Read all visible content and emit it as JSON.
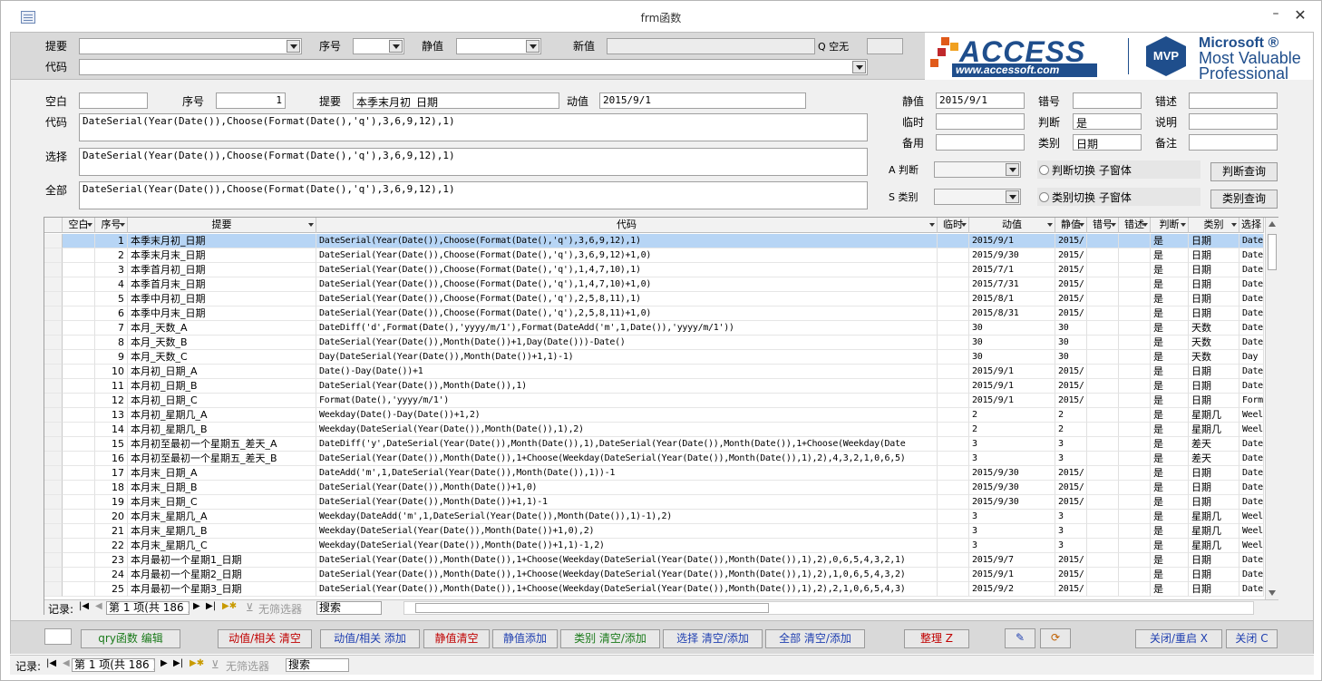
{
  "window": {
    "title": "frm函数",
    "minimize": "–",
    "close": "✕"
  },
  "header": {
    "tiyao_label": "提要",
    "xuhao_label": "序号",
    "jingzhi_label": "静值",
    "xinzhi_label": "新值",
    "q_label": "Q 空无",
    "daima_label": "代码"
  },
  "logo": {
    "access": "ACCESS",
    "url": "www.accessoft.com",
    "mvp": "MVP",
    "ms1": "Microsoft ®",
    "ms2": "Most Valuable",
    "ms3": "Professional"
  },
  "detail": {
    "kongbai_label": "空白",
    "kongbai_value": "",
    "xuhao_label": "序号",
    "xuhao_value": "1",
    "tiyao_label": "提要",
    "tiyao_value": "本季末月初_日期",
    "dongzhi_label": "动值",
    "dongzhi_value": "2015/9/1",
    "jingzhi_label": "静值",
    "jingzhi_value": "2015/9/1",
    "cuohao_label": "错号",
    "cuohao_value": "",
    "cuoshu_label": "错述",
    "cuoshu_value": "",
    "daima_label": "代码",
    "daima_value": "DateSerial(Year(Date()),Choose(Format(Date(),'q'),3,6,9,12),1)",
    "linshi_label": "临时",
    "linshi_value": "",
    "panduan_label": "判断",
    "panduan_value": "是",
    "shuoming_label": "说明",
    "shuoming_value": "",
    "beiyong_label": "备用",
    "beiyong_value": "",
    "leibie_label": "类别",
    "leibie_value": "日期",
    "beizhu_label": "备注",
    "beizhu_value": "",
    "xuanze_label": "选择",
    "xuanze_value": "DateSerial(Year(Date()),Choose(Format(Date(),'q'),3,6,9,12),1)",
    "quanbu_label": "全部",
    "quanbu_value": "DateSerial(Year(Date()),Choose(Format(Date(),'q'),3,6,9,12),1)",
    "a_panduan_label": "A 判断",
    "s_leibie_label": "S 类别",
    "panduan_switch": "判断切换 子窗体",
    "leibie_switch": "类别切换 子窗体",
    "panduan_query": "判断查询",
    "leibie_query": "类别查询"
  },
  "grid": {
    "columns": [
      "空白",
      "序号",
      "提要",
      "代码",
      "临时",
      "动值",
      "静值",
      "错号",
      "错述",
      "判断",
      "类别",
      "选择"
    ],
    "rows": [
      [
        "1",
        "本季末月初_日期",
        "DateSerial(Year(Date()),Choose(Format(Date(),'q'),3,6,9,12),1)",
        "2015/9/1",
        "2015/'",
        "是",
        "日期",
        "Date"
      ],
      [
        "2",
        "本季末月末_日期",
        "DateSerial(Year(Date()),Choose(Format(Date(),'q'),3,6,9,12)+1,0)",
        "2015/9/30",
        "2015/'",
        "是",
        "日期",
        "Date"
      ],
      [
        "3",
        "本季首月初_日期",
        "DateSerial(Year(Date()),Choose(Format(Date(),'q'),1,4,7,10),1)",
        "2015/7/1",
        "2015/'",
        "是",
        "日期",
        "Date"
      ],
      [
        "4",
        "本季首月末_日期",
        "DateSerial(Year(Date()),Choose(Format(Date(),'q'),1,4,7,10)+1,0)",
        "2015/7/31",
        "2015/'",
        "是",
        "日期",
        "Date"
      ],
      [
        "5",
        "本季中月初_日期",
        "DateSerial(Year(Date()),Choose(Format(Date(),'q'),2,5,8,11),1)",
        "2015/8/1",
        "2015/'",
        "是",
        "日期",
        "Date"
      ],
      [
        "6",
        "本季中月末_日期",
        "DateSerial(Year(Date()),Choose(Format(Date(),'q'),2,5,8,11)+1,0)",
        "2015/8/31",
        "2015/'",
        "是",
        "日期",
        "Date"
      ],
      [
        "7",
        "本月_天数_A",
        "DateDiff('d',Format(Date(),'yyyy/m/1'),Format(DateAdd('m',1,Date()),'yyyy/m/1'))",
        "30",
        "30",
        "是",
        "天数",
        "Date"
      ],
      [
        "8",
        "本月_天数_B",
        "DateSerial(Year(Date()),Month(Date())+1,Day(Date()))-Date()",
        "30",
        "30",
        "是",
        "天数",
        "Date"
      ],
      [
        "9",
        "本月_天数_C",
        "Day(DateSerial(Year(Date()),Month(Date())+1,1)-1)",
        "30",
        "30",
        "是",
        "天数",
        "Day"
      ],
      [
        "10",
        "本月初_日期_A",
        "Date()-Day(Date())+1",
        "2015/9/1",
        "2015/'",
        "是",
        "日期",
        "Date"
      ],
      [
        "11",
        "本月初_日期_B",
        "DateSerial(Year(Date()),Month(Date()),1)",
        "2015/9/1",
        "2015/'",
        "是",
        "日期",
        "Date"
      ],
      [
        "12",
        "本月初_日期_C",
        "Format(Date(),'yyyy/m/1')",
        "2015/9/1",
        "2015/'",
        "是",
        "日期",
        "Form"
      ],
      [
        "13",
        "本月初_星期几_A",
        "Weekday(Date()-Day(Date())+1,2)",
        "2",
        "2",
        "是",
        "星期几",
        "Weel"
      ],
      [
        "14",
        "本月初_星期几_B",
        "Weekday(DateSerial(Year(Date()),Month(Date()),1),2)",
        "2",
        "2",
        "是",
        "星期几",
        "Weel"
      ],
      [
        "15",
        "本月初至最初一个星期五_差天_A",
        "DateDiff('y',DateSerial(Year(Date()),Month(Date()),1),DateSerial(Year(Date()),Month(Date()),1+Choose(Weekday(Date",
        "3",
        "3",
        "是",
        "差天",
        "Date"
      ],
      [
        "16",
        "本月初至最初一个星期五_差天_B",
        "DateSerial(Year(Date()),Month(Date()),1+Choose(Weekday(DateSerial(Year(Date()),Month(Date()),1),2),4,3,2,1,0,6,5)",
        "3",
        "3",
        "是",
        "差天",
        "Date"
      ],
      [
        "17",
        "本月末_日期_A",
        "DateAdd('m',1,DateSerial(Year(Date()),Month(Date()),1))-1",
        "2015/9/30",
        "2015/'",
        "是",
        "日期",
        "Date"
      ],
      [
        "18",
        "本月末_日期_B",
        "DateSerial(Year(Date()),Month(Date())+1,0)",
        "2015/9/30",
        "2015/'",
        "是",
        "日期",
        "Date"
      ],
      [
        "19",
        "本月末_日期_C",
        "DateSerial(Year(Date()),Month(Date())+1,1)-1",
        "2015/9/30",
        "2015/'",
        "是",
        "日期",
        "Date"
      ],
      [
        "20",
        "本月末_星期几_A",
        "Weekday(DateAdd('m',1,DateSerial(Year(Date()),Month(Date()),1)-1),2)",
        "3",
        "3",
        "是",
        "星期几",
        "Weel"
      ],
      [
        "21",
        "本月末_星期几_B",
        "Weekday(DateSerial(Year(Date()),Month(Date())+1,0),2)",
        "3",
        "3",
        "是",
        "星期几",
        "Weel"
      ],
      [
        "22",
        "本月末_星期几_C",
        "Weekday(DateSerial(Year(Date()),Month(Date())+1,1)-1,2)",
        "3",
        "3",
        "是",
        "星期几",
        "Weel"
      ],
      [
        "23",
        "本月最初一个星期1_日期",
        "DateSerial(Year(Date()),Month(Date()),1+Choose(Weekday(DateSerial(Year(Date()),Month(Date()),1),2),0,6,5,4,3,2,1)",
        "2015/9/7",
        "2015/'",
        "是",
        "日期",
        "Date"
      ],
      [
        "24",
        "本月最初一个星期2_日期",
        "DateSerial(Year(Date()),Month(Date()),1+Choose(Weekday(DateSerial(Year(Date()),Month(Date()),1),2),1,0,6,5,4,3,2)",
        "2015/9/1",
        "2015/'",
        "是",
        "日期",
        "Date"
      ],
      [
        "25",
        "本月最初一个星期3_日期",
        "DateSerial(Year(Date()),Month(Date()),1+Choose(Weekday(DateSerial(Year(Date()),Month(Date()),1),2),2,1,0,6,5,4,3)",
        "2015/9/2",
        "2015/'",
        "是",
        "日期",
        "Date"
      ]
    ],
    "nav": {
      "record_label": "记录:",
      "position": "第 1 项(共 186 ]",
      "no_filter": "无筛选器",
      "search": "搜索"
    }
  },
  "buttons": {
    "qry": "qry函数 编辑",
    "dong_clear": "动值/相关 清空",
    "dong_add": "动值/相关 添加",
    "jing_clear": "静值清空",
    "jing_add": "静值添加",
    "lei_clear": "类别 清空/添加",
    "xuan_clear": "选择 清空/添加",
    "quan_clear": "全部 清空/添加",
    "zhengli": "整理 Z",
    "close_restart": "关闭/重启 X",
    "close": "关闭 C"
  },
  "status": {
    "record_label": "记录:",
    "position": "第 1 项(共 186 ]",
    "no_filter": "无筛选器",
    "search": "搜索"
  },
  "colors": {
    "red": "#c00000",
    "blue": "#1f3fb0",
    "green": "#1a7a1a",
    "logo_blue": "#1f4e8c",
    "selected_row": "#b7d5f5"
  }
}
